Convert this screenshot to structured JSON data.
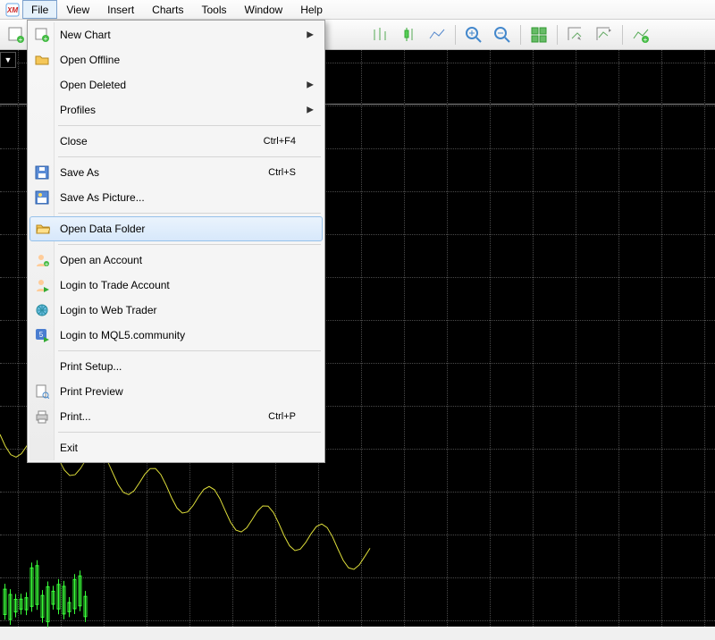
{
  "menubar": {
    "items": [
      "File",
      "View",
      "Insert",
      "Charts",
      "Tools",
      "Window",
      "Help"
    ]
  },
  "file_menu": {
    "new_chart": "New Chart",
    "open_offline": "Open Offline",
    "open_deleted": "Open Deleted",
    "profiles": "Profiles",
    "close": "Close",
    "close_sc": "Ctrl+F4",
    "save_as": "Save As",
    "save_as_sc": "Ctrl+S",
    "save_as_picture": "Save As Picture...",
    "open_data_folder": "Open Data Folder",
    "open_account": "Open an Account",
    "login_trade": "Login to Trade Account",
    "login_web": "Login to Web Trader",
    "login_mql5": "Login to MQL5.community",
    "print_setup": "Print Setup...",
    "print_preview": "Print Preview",
    "print": "Print...",
    "print_sc": "Ctrl+P",
    "exit": "Exit"
  }
}
